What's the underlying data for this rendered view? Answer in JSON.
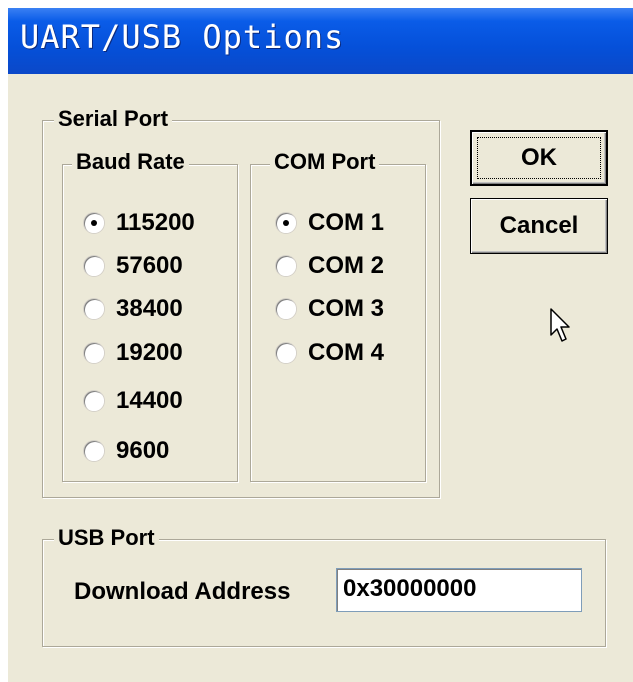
{
  "window": {
    "title": "UART/USB Options"
  },
  "serial_port": {
    "label": "Serial Port",
    "baud_rate": {
      "label": "Baud Rate",
      "options": [
        "115200",
        "57600",
        "38400",
        "19200",
        "14400",
        "9600"
      ],
      "selected": "115200"
    },
    "com_port": {
      "label": "COM Port",
      "options": [
        "COM 1",
        "COM 2",
        "COM 3",
        "COM 4"
      ],
      "selected": "COM 1"
    }
  },
  "buttons": {
    "ok": "OK",
    "cancel": "Cancel"
  },
  "usb_port": {
    "label": "USB Port",
    "download_address_label": "Download Address",
    "download_address_value": "0x30000000"
  },
  "icons": {
    "pointer": "mouse-pointer-icon"
  },
  "colors": {
    "titlebar": "#0550d9",
    "dialog_bg": "#ece9d8"
  }
}
